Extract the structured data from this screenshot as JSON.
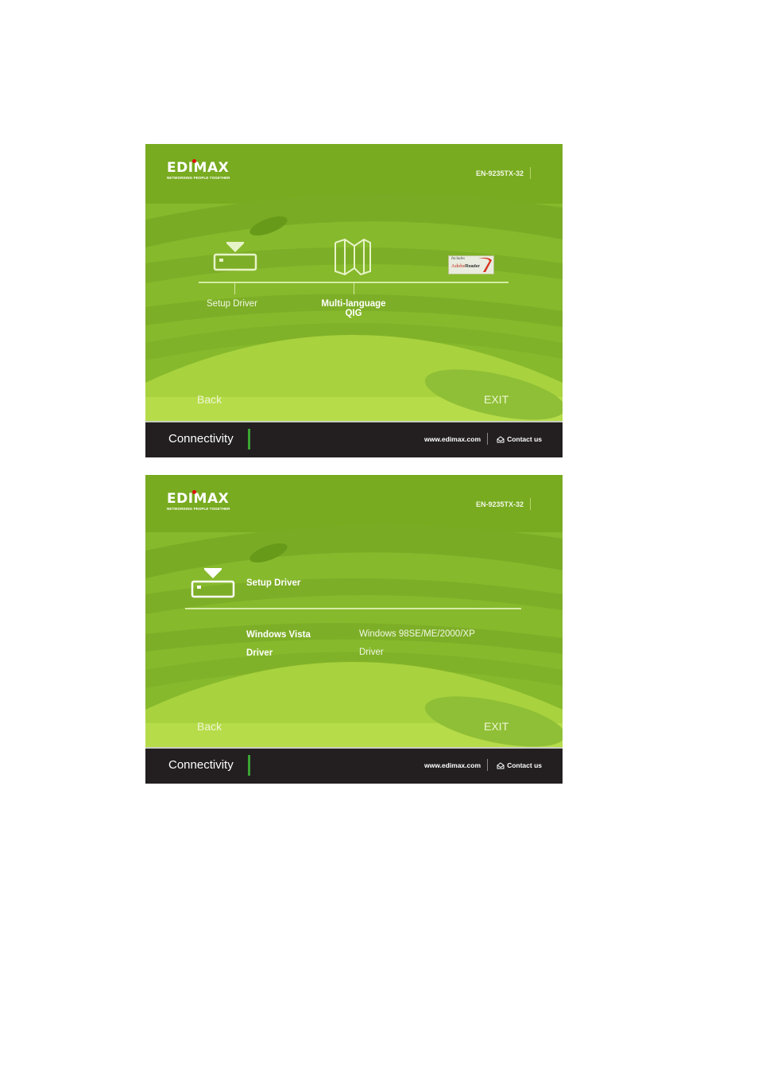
{
  "brand": {
    "logo_text": "EDIMAX",
    "tagline": "NETWORKING PEOPLE TOGETHER",
    "model": "EN-9235TX-32"
  },
  "colors": {
    "green_bg": "#7fb22a",
    "light_green": "#b6dc4a",
    "footer_bg": "#231f20",
    "accent_bar": "#3aa535",
    "logo_dot": "#e01010"
  },
  "screen1": {
    "menu": [
      {
        "label": "Setup Driver",
        "icon": "driver-install-icon"
      },
      {
        "label_line1": "Multi-language",
        "label_line2": "QIG",
        "icon": "folded-map-icon"
      },
      {
        "icon": "adobe-reader-badge",
        "badge_line1": "Includes",
        "badge_line2": "Adobe",
        "badge_line3": "Reader"
      }
    ],
    "back_label": "Back",
    "exit_label": "EXIT"
  },
  "screen2": {
    "section_title": "Setup Driver",
    "options": [
      {
        "line1": "Windows Vista",
        "line2": "Driver"
      },
      {
        "line1": "Windows 98SE/ME/2000/XP",
        "line2": "Driver"
      }
    ],
    "back_label": "Back",
    "exit_label": "EXIT"
  },
  "footer": {
    "title": "Connectivity",
    "url": "www.edimax.com",
    "contact_label": "Contact us"
  }
}
